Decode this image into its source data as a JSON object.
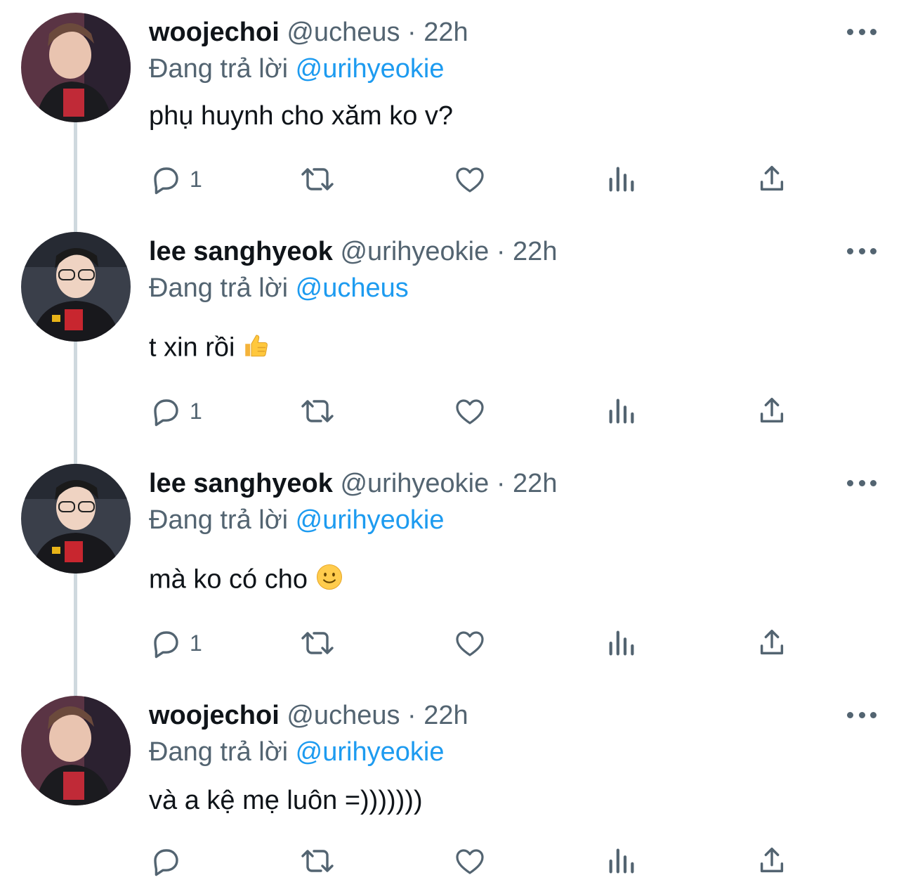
{
  "tweets": [
    {
      "name": "woojechoi",
      "handle": "@ucheus",
      "sep": "·",
      "time": "22h",
      "reply_prefix": "Đang trả lời",
      "reply_to": "@urihyeokie",
      "text": "phụ huynh cho xăm ko v?",
      "reply_count": "1"
    },
    {
      "name": "lee sanghyeok",
      "handle": "@urihyeokie",
      "sep": "·",
      "time": "22h",
      "reply_prefix": "Đang trả lời",
      "reply_to": "@ucheus",
      "text": "t xin rồi",
      "reply_count": "1"
    },
    {
      "name": "lee sanghyeok",
      "handle": "@urihyeokie",
      "sep": "·",
      "time": "22h",
      "reply_prefix": "Đang trả lời",
      "reply_to": "@urihyeokie",
      "text": "mà ko có cho",
      "reply_count": "1"
    },
    {
      "name": "woojechoi",
      "handle": "@ucheus",
      "sep": "·",
      "time": "22h",
      "reply_prefix": "Đang trả lời",
      "reply_to": "@urihyeokie",
      "text": "và a kệ mẹ luôn =)))))))",
      "reply_count": ""
    }
  ],
  "icons": {
    "reply": "reply-icon",
    "retweet": "retweet-icon",
    "like": "heart-icon",
    "views": "views-icon",
    "share": "share-icon",
    "more": "more-icon",
    "thumbs_up": "thumbs-up-emoji",
    "smile": "slightly-smiling-emoji"
  },
  "colors": {
    "text": "#0f1419",
    "secondary": "#536471",
    "link": "#1d9bf0",
    "thread_line": "#cfd9de"
  }
}
